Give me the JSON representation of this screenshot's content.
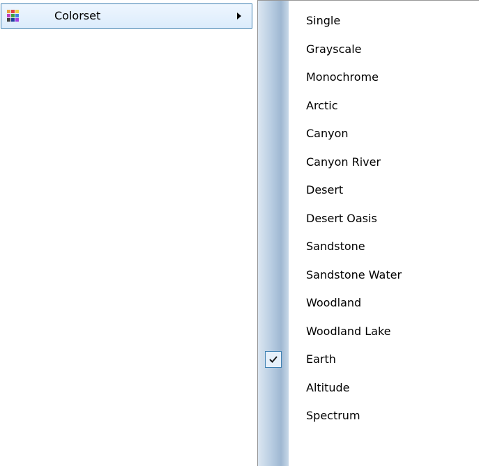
{
  "parent_menu": {
    "label": "Colorset",
    "icon": "colorset-grid-icon",
    "has_submenu": true
  },
  "submenu": {
    "items": [
      {
        "label": "Single",
        "checked": false
      },
      {
        "label": "Grayscale",
        "checked": false
      },
      {
        "label": "Monochrome",
        "checked": false
      },
      {
        "label": "Arctic",
        "checked": false
      },
      {
        "label": "Canyon",
        "checked": false
      },
      {
        "label": "Canyon River",
        "checked": false
      },
      {
        "label": "Desert",
        "checked": false
      },
      {
        "label": "Desert Oasis",
        "checked": false
      },
      {
        "label": "Sandstone",
        "checked": false
      },
      {
        "label": "Sandstone Water",
        "checked": false
      },
      {
        "label": "Woodland",
        "checked": false
      },
      {
        "label": "Woodland Lake",
        "checked": false
      },
      {
        "label": "Earth",
        "checked": true
      },
      {
        "label": "Altitude",
        "checked": false
      },
      {
        "label": "Spectrum",
        "checked": false
      }
    ]
  },
  "colors": {
    "highlight_border": "#3c7fb1",
    "highlight_fill": "#dcecfc",
    "menu_border": "#979797"
  }
}
